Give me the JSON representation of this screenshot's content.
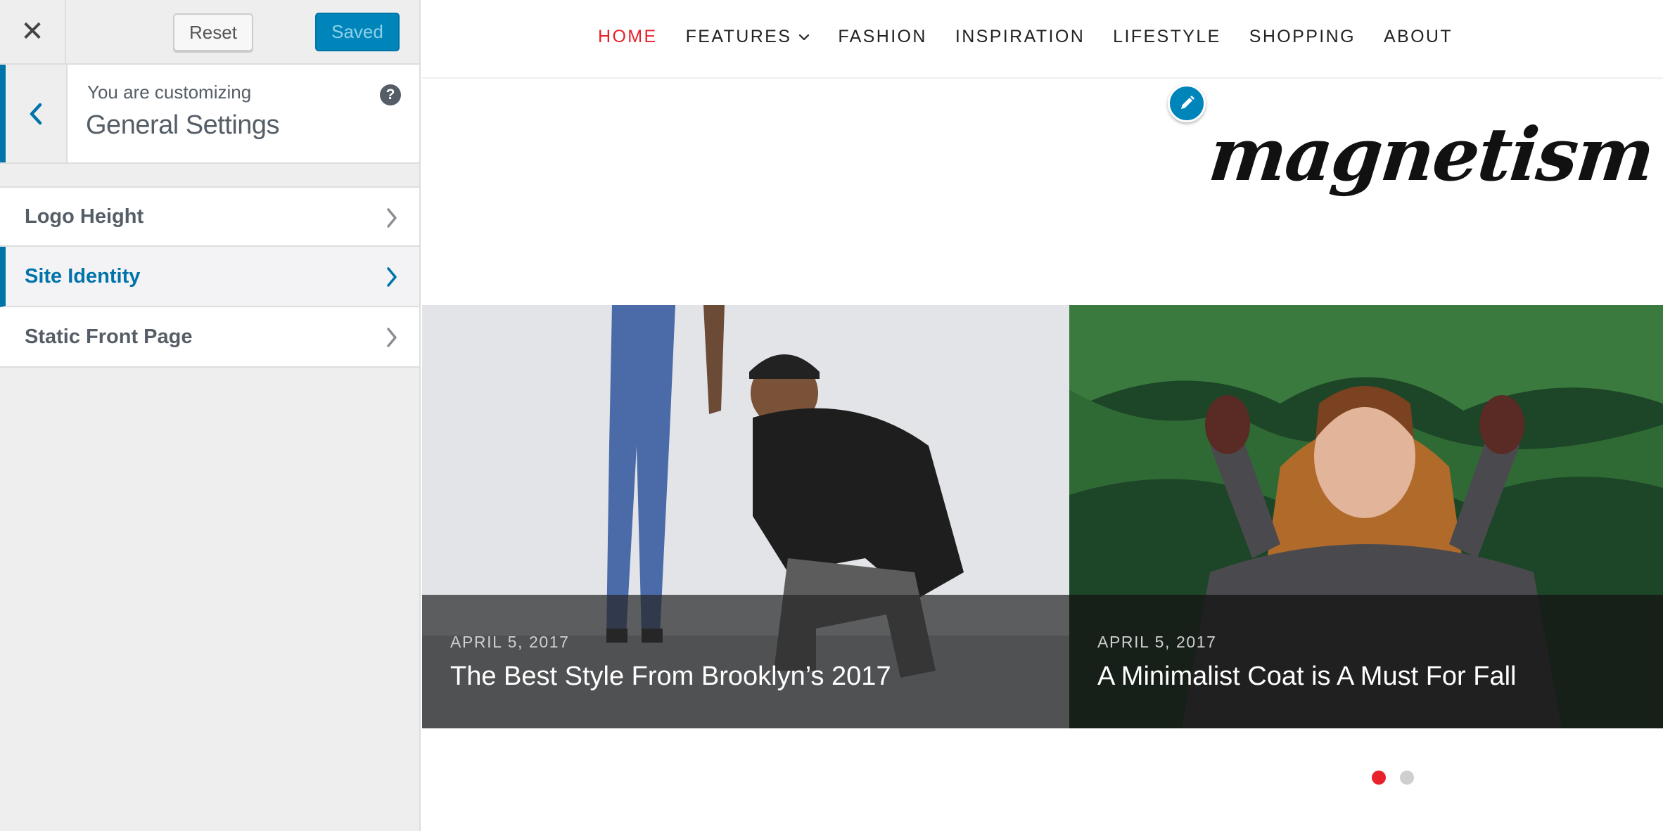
{
  "sidebar": {
    "header": {
      "close_glyph": "✕",
      "reset_label": "Reset",
      "saved_label": "Saved"
    },
    "section_info": {
      "customizing_label": "You are customizing",
      "title": "General Settings",
      "help_glyph": "?"
    },
    "controls": [
      {
        "label": "Logo Height",
        "active": false
      },
      {
        "label": "Site Identity",
        "active": true
      },
      {
        "label": "Static Front Page",
        "active": false
      }
    ]
  },
  "preview": {
    "nav": [
      {
        "label": "HOME",
        "current": true
      },
      {
        "label": "FEATURES",
        "has_dropdown": true
      },
      {
        "label": "FASHION"
      },
      {
        "label": "INSPIRATION"
      },
      {
        "label": "LIFESTYLE"
      },
      {
        "label": "SHOPPING"
      },
      {
        "label": "ABOUT"
      }
    ],
    "logo_text": "magnetism",
    "slides": [
      {
        "date": "APRIL 5, 2017",
        "title": "The Best Style From Brooklyn’s 2017"
      },
      {
        "date": "APRIL 5, 2017",
        "title": "A Minimalist Coat is A Must For Fall"
      }
    ],
    "pagination": {
      "total": 2,
      "current": 1
    }
  },
  "colors": {
    "accent_blue": "#0073aa",
    "button_blue": "#0085ba",
    "brand_red": "#e8212b"
  }
}
